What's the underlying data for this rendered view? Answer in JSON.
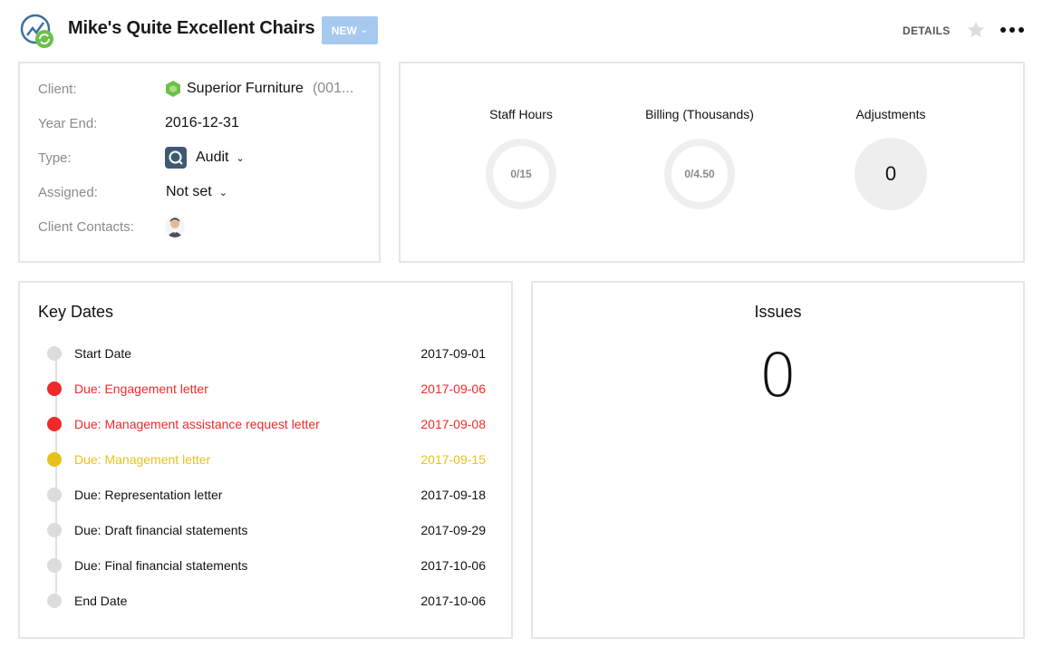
{
  "header": {
    "title": "Mike's Quite Excellent Chairs",
    "status_label": "NEW",
    "details_label": "DETAILS",
    "logo_icon": "engagement-logo-icon",
    "star_icon": "star-icon",
    "more_icon": "more-options-icon"
  },
  "info": {
    "client_label": "Client:",
    "client_name": "Superior Furniture",
    "client_code": "(001...",
    "year_end_label": "Year End:",
    "year_end_value": "2016-12-31",
    "type_label": "Type:",
    "type_value": "Audit",
    "assigned_label": "Assigned:",
    "assigned_value": "Not set",
    "contacts_label": "Client Contacts:"
  },
  "metrics": {
    "staff_hours": {
      "title": "Staff Hours",
      "value": "0/15"
    },
    "billing": {
      "title": "Billing (Thousands)",
      "value": "0/4.50"
    },
    "adjustments": {
      "title": "Adjustments",
      "value": "0"
    }
  },
  "key_dates": {
    "title": "Key Dates",
    "items": [
      {
        "label": "Start Date",
        "date": "2017-09-01",
        "status": "neutral"
      },
      {
        "label": "Due: Engagement letter",
        "date": "2017-09-06",
        "status": "overdue"
      },
      {
        "label": "Due: Management assistance request letter",
        "date": "2017-09-08",
        "status": "overdue"
      },
      {
        "label": "Due: Management letter",
        "date": "2017-09-15",
        "status": "upcoming"
      },
      {
        "label": "Due: Representation letter",
        "date": "2017-09-18",
        "status": "neutral"
      },
      {
        "label": "Due: Draft financial statements",
        "date": "2017-09-29",
        "status": "neutral"
      },
      {
        "label": "Due: Final financial statements",
        "date": "2017-10-06",
        "status": "neutral"
      },
      {
        "label": "End Date",
        "date": "2017-10-06",
        "status": "neutral"
      }
    ]
  },
  "issues": {
    "title": "Issues",
    "count": "0"
  },
  "colors": {
    "overdue": "#f02a2a",
    "upcoming": "#e8c21b",
    "neutral_dot": "#dcdcdc",
    "neutral_text": "#111111",
    "status_button": "#a7c9ef",
    "client_hex": "#6cc04a",
    "type_icon": "#3d5a72"
  }
}
